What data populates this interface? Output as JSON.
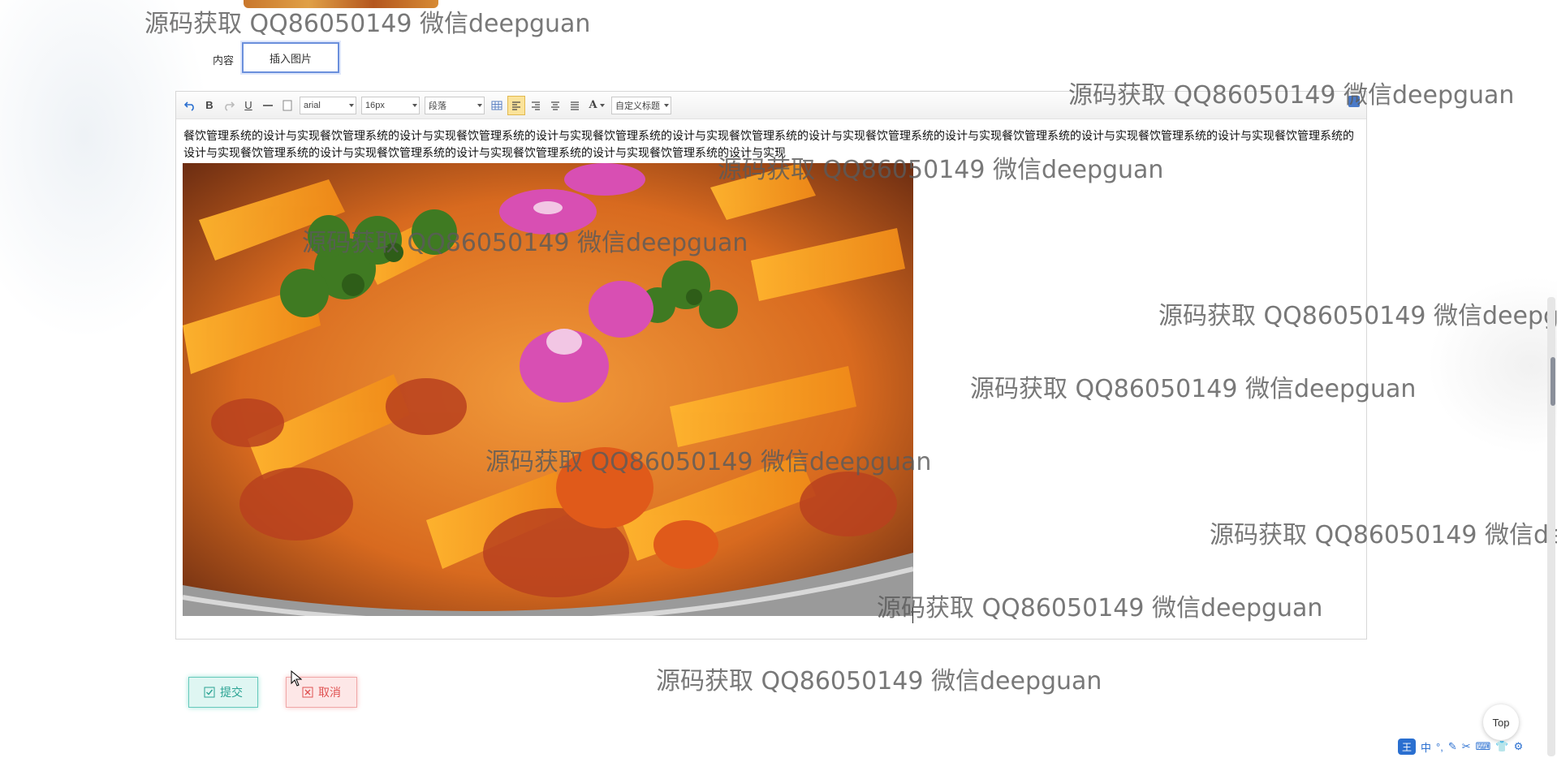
{
  "form": {
    "content_label": "内容",
    "insert_image_label": "插入图片"
  },
  "toolbar": {
    "font_family": "arial",
    "font_size": "16px",
    "paragraph": "段落",
    "custom_title": "自定义标题",
    "bold": "B",
    "underline": "U",
    "font_color": "A"
  },
  "editor": {
    "text": "餐饮管理系统的设计与实现餐饮管理系统的设计与实现餐饮管理系统的设计与实现餐饮管理系统的设计与实现餐饮管理系统的设计与实现餐饮管理系统的设计与实现餐饮管理系统的设计与实现餐饮管理系统的设计与实现餐饮管理系统的设计与实现餐饮管理系统的设计与实现餐饮管理系统的设计与实现餐饮管理系统的设计与实现餐饮管理系统的设计与实现"
  },
  "actions": {
    "submit_label": "提交",
    "cancel_label": "取消"
  },
  "back_to_top": "Top",
  "taskbar": {
    "ime_icon": "王",
    "ime_mode": "中"
  },
  "watermarks": [
    "源码获取 QQ86050149 微信deepguan",
    "源码获取 QQ86050149 微信deepguan",
    "源码获取 QQ86050149 微信deepguan",
    "源码获取 QQ86050149 微信deepguan",
    "源码获取 QQ86050149 微信deepgu",
    "源码获取 QQ86050149 微信deepguan",
    "源码获取 QQ86050149 微信deepguan",
    "源码获取 QQ86050149 微信de",
    "源码获取 QQ86050149 微信deepguan",
    "源码获取 QQ86050149 微信deepguan"
  ],
  "colors": {
    "submit": "#2aa393",
    "cancel": "#e05353",
    "active_tool": "#fbe39a"
  }
}
